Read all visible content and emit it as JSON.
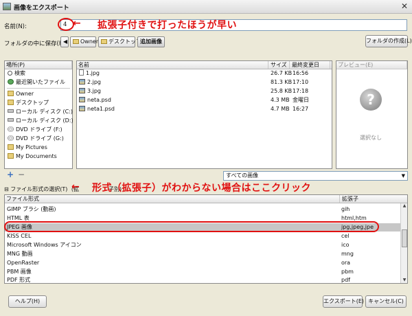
{
  "window": {
    "title": "画像をエクスポート",
    "close_glyph": "✕"
  },
  "name_field": {
    "label": "名前(N):",
    "value": "4"
  },
  "save_in": {
    "label": "フォルダの中に保存(F):",
    "back_glyph": "◀",
    "crumbs": [
      "Owner",
      "デスクトップ",
      "追加画像"
    ]
  },
  "create_folder_button": "フォルダの作成(L)",
  "places": {
    "header": "場所(P)",
    "items": [
      {
        "label": "検索",
        "icon": "search-icon"
      },
      {
        "label": "最近開いたファイル",
        "icon": "recent-icon"
      },
      {
        "label": "Owner",
        "icon": "folder-icon"
      },
      {
        "label": "デスクトップ",
        "icon": "folder-icon"
      },
      {
        "label": "ローカル ディスク (C:)",
        "icon": "drive-icon"
      },
      {
        "label": "ローカル ディスク (D:)",
        "icon": "drive-icon"
      },
      {
        "label": "DVD ドライブ (F:)",
        "icon": "dvd-icon"
      },
      {
        "label": "DVD ドライブ (G:)",
        "icon": "dvd-icon"
      },
      {
        "label": "My Pictures",
        "icon": "folder-icon"
      },
      {
        "label": "My Documents",
        "icon": "folder-icon"
      }
    ],
    "add_glyph": "+",
    "remove_glyph": "−"
  },
  "files": {
    "columns": [
      "名前",
      "サイズ",
      "最終変更日"
    ],
    "rows": [
      {
        "name": "1.jpg",
        "size": "26.7 KB",
        "modified": "16:56",
        "icon": "file-icon"
      },
      {
        "name": "2.jpg",
        "size": "81.3 KB",
        "modified": "17:10",
        "icon": "image-icon"
      },
      {
        "name": "3.jpg",
        "size": "25.8 KB",
        "modified": "17:18",
        "icon": "image-icon"
      },
      {
        "name": "neta.psd",
        "size": "4.3 MB",
        "modified": "金曜日",
        "icon": "image-icon"
      },
      {
        "name": "neta1.psd",
        "size": "4.7 MB",
        "modified": "16:27",
        "icon": "image-icon"
      }
    ]
  },
  "preview": {
    "header": "プレビュー(E)",
    "no_selection": "選択なし",
    "glyph": "?"
  },
  "filter": {
    "value": "すべての画像",
    "arrow": "▼"
  },
  "file_type": {
    "expander_label": "⊟ ファイル形式の選択(T)",
    "expander_tail": "(拡",
    "expander_tail2": "子別)",
    "columns": [
      "ファイル形式",
      "拡張子"
    ],
    "rows": [
      {
        "name": "GIMP ブラシ (動画)",
        "ext": "gih"
      },
      {
        "name": "HTML 表",
        "ext": "html,htm"
      },
      {
        "name": "JPEG 画像",
        "ext": "jpg,jpeg,jpe",
        "selected": true
      },
      {
        "name": "KISS CEL",
        "ext": "cel"
      },
      {
        "name": "Microsoft Windows アイコン",
        "ext": "ico"
      },
      {
        "name": "MNG 動画",
        "ext": "mng"
      },
      {
        "name": "OpenRaster",
        "ext": "ora"
      },
      {
        "name": "PBM 画像",
        "ext": "pbm"
      },
      {
        "name": "PDF 形式",
        "ext": "pdf"
      }
    ]
  },
  "buttons": {
    "help": "ヘルプ(H)",
    "export": "エクスポート(E)",
    "cancel": "キャンセル(C)"
  },
  "annotations": {
    "top": "拡張子付きで打ったほうが早い",
    "middle": "形式（拡張子）がわからない場合はここクリック",
    "arrow": "←"
  },
  "colors": {
    "annotation": "#e01010",
    "selection": "#c7c7c7"
  }
}
